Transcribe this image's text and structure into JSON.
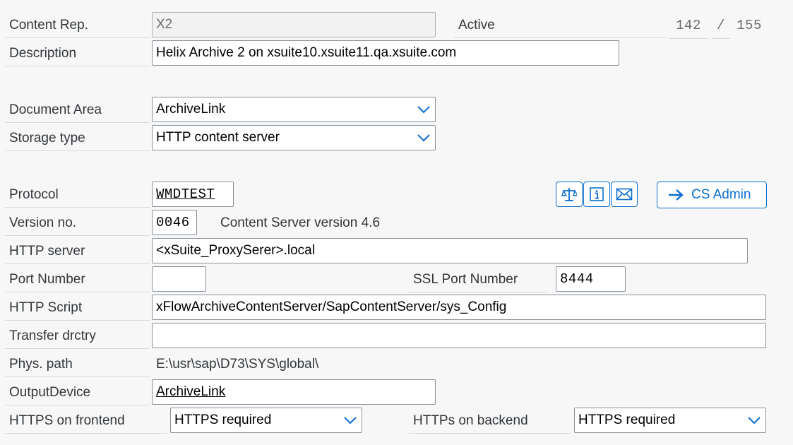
{
  "header": {
    "content_rep_label": "Content Rep.",
    "content_rep_value": "X2",
    "status_label": "Active",
    "counter_current": "142",
    "counter_sep": "/",
    "counter_total": "155"
  },
  "description": {
    "label": "Description",
    "value": "Helix Archive 2 on xsuite10.xsuite11.qa.xsuite.com"
  },
  "document_area": {
    "label": "Document Area",
    "value": "ArchiveLink"
  },
  "storage_type": {
    "label": "Storage type",
    "value": "HTTP content server"
  },
  "protocol": {
    "label": "Protocol",
    "value": "WMDTEST"
  },
  "toolbar": {
    "cs_admin_label": "CS Admin"
  },
  "version": {
    "label": "Version no.",
    "value": "0046",
    "info": "Content Server version 4.6"
  },
  "http_server": {
    "label": "HTTP server",
    "value": "<xSuite_ProxySerer>.local"
  },
  "port": {
    "label": "Port Number",
    "value": "",
    "ssl_label": "SSL Port Number",
    "ssl_value": "8444"
  },
  "http_script": {
    "label": "HTTP Script",
    "value": "xFlowArchiveContentServer/SapContentServer/sys_Config"
  },
  "transfer": {
    "label": "Transfer drctry",
    "value": ""
  },
  "phys_path": {
    "label": "Phys. path",
    "value": "E:\\usr\\sap\\D73\\SYS\\global\\"
  },
  "output_device": {
    "label": "OutputDevice",
    "value": "ArchiveLink"
  },
  "https_frontend": {
    "label": "HTTPS on frontend",
    "value": "HTTPS required"
  },
  "https_backend": {
    "label": "HTTPs on backend",
    "value": "HTTPS required"
  },
  "colors": {
    "accent": "#0a6ed1",
    "background": "#f7f7f7",
    "border": "#89919a"
  },
  "icons": [
    "compare-icon",
    "info-icon",
    "mail-icon",
    "arrow-right-icon",
    "chevron-down-icon"
  ]
}
